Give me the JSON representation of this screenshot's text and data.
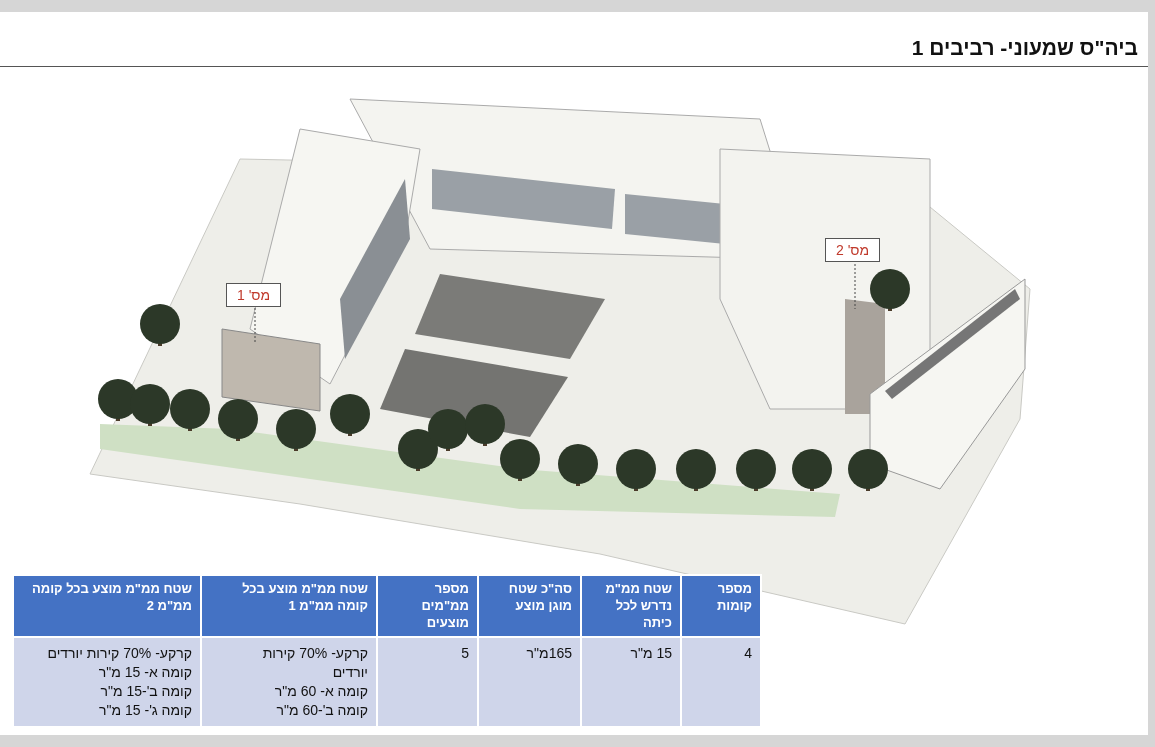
{
  "slide": {
    "title": "ביה\"ס שמעוני- רביבים 1"
  },
  "callouts": [
    {
      "label": "מס' 1"
    },
    {
      "label": "מס' 2"
    }
  ],
  "table": {
    "columns": [
      "מספר\nקומות",
      "שטח ממ\"מ\nנדרש לכל\nכיתה",
      "סה\"כ שטח\nמוגן מוצע",
      "מספר\nממ\"מים\nמוצעים",
      "שטח ממ\"מ מוצע בכל\nקומה ממ\"מ 1",
      "שטח ממ\"מ מוצע בכל קומה\nממ\"מ 2"
    ],
    "rows": [
      [
        "4",
        "15 מ\"ר",
        "165מ\"ר",
        "5",
        "קרקע- 70% קירות\nיורדים\nקומה א- 60 מ\"ר\nקומה ב'-60 מ\"ר",
        "קרקע- 70% קירות יורדים\nקומה א- 15 מ\"ר\nקומה ב'-15 מ\"ר\nקומה ג'- 15 מ\"ר"
      ]
    ]
  }
}
